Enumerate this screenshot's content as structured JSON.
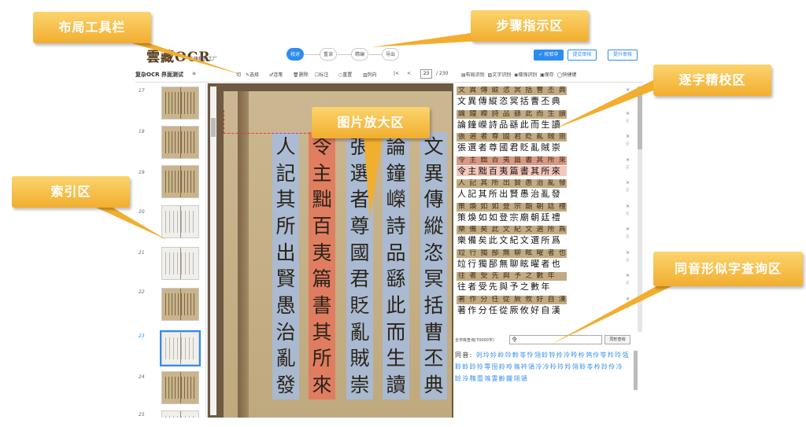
{
  "header": {
    "logo": "雲藏OCR",
    "logo_sub": "古籍精校工厂",
    "steps": [
      "校对",
      "重读",
      "精编",
      "导出"
    ],
    "buttons": [
      "✓ 校验中",
      "提交审核",
      "提升审核"
    ]
  },
  "layout_toolbar": {
    "project_name": "复杂OCR 界面测试",
    "tools": [
      "切",
      "选择",
      "连笔",
      "删除",
      "标注",
      "重置",
      "列向"
    ],
    "nav": [
      "|<",
      "<"
    ],
    "page_current": "23",
    "page_total": "/ 230"
  },
  "index": {
    "pages": [
      {
        "num": "17",
        "style": "dark"
      },
      {
        "num": "18",
        "style": "dark"
      },
      {
        "num": "19",
        "style": "dark"
      },
      {
        "num": "20",
        "style": "light"
      },
      {
        "num": "21",
        "style": "light"
      },
      {
        "num": "22",
        "style": "dark"
      },
      {
        "num": "23",
        "style": "light",
        "active": true
      },
      {
        "num": "24",
        "style": "dark"
      },
      {
        "num": "25",
        "style": "light"
      }
    ]
  },
  "image_view": {
    "columns": [
      {
        "text": "文異傳縱恣冥括曹丕典",
        "highlight": "blue"
      },
      {
        "text": "論鐘嶸詩品繇此而生讀",
        "highlight": "blue"
      },
      {
        "text": "張選者尊國君貶亂賊崇",
        "highlight": "blue"
      },
      {
        "text": "令主黜百夷篇書其所來",
        "highlight": "red"
      },
      {
        "text": "人記其所出賢愚治亂發",
        "highlight": "blue"
      }
    ]
  },
  "proof_toolbar": {
    "tools": [
      "布局识别",
      "文字识别",
      "增强识别",
      "保存",
      "快捷键"
    ]
  },
  "proof_rows": [
    {
      "img_text": "文異傳縱恣冥括曹丕典",
      "text": "文異傳縱恣冥括曹丕典",
      "selected": false
    },
    {
      "img_text": "論鐘嶸詩品繇此而生讀",
      "text": "論鐘嶸詩品繇此而生讀",
      "selected": false
    },
    {
      "img_text": "張選者尊國君貶亂賊崇",
      "text": "張選者尊國君貶亂賊崇",
      "selected": false
    },
    {
      "img_text": "令主黜百夷篇書其所來",
      "text": "令主黜百夷篇書其所來",
      "selected": true
    },
    {
      "img_text": "人記其所出賢愚治亂發",
      "text": "人記其所出賢愚治亂發",
      "selected": false
    },
    {
      "img_text": "策煥如如登宗廟朝廷禮",
      "text": "策煥如如登宗廟朝廷禮",
      "selected": false
    },
    {
      "img_text": "樂備矣此文紀文選所爲",
      "text": "樂備矣此文紀文選所爲",
      "selected": false
    },
    {
      "img_text": "竝行獨郚無聊眩曜者也",
      "text": "竝行獨郚無聊眩曜者也",
      "selected": false
    },
    {
      "img_text": "往者受先與予之數年",
      "text": "往者受先與予之數年",
      "selected": false
    },
    {
      "img_text": "著作分任從厥攸好自漢",
      "text": "著作分任從厥攸好自漢",
      "selected": false
    }
  ],
  "lookup": {
    "label": "全字库查询(70000字)",
    "input_value": "令",
    "button": "同形查询",
    "result_label": "同音:",
    "results": "刢坽姈岭竛軨苓怜翎蛉铃拎泠昤柃鸰伶笭羚玲瓴聆蛉跉狑零囹鈴呤鴒衿領冷冷秢玲羚翎聆苓柃跉伶冷䍅泠䴇蘦鴒霊齡鑞翎領"
  },
  "callouts": {
    "layout_toolbar": "布局工具栏",
    "step_area": "步骤指示区",
    "proof_area": "逐字精校区",
    "zoom_area": "图片放大区",
    "index_area": "索引区",
    "lookup_area": "同音形似字查询区"
  },
  "colors": {
    "accent": "#2d8cf0",
    "callout": "#f2ae2f",
    "highlight_blue": "#a0bee9",
    "highlight_red": "#e4765c"
  }
}
